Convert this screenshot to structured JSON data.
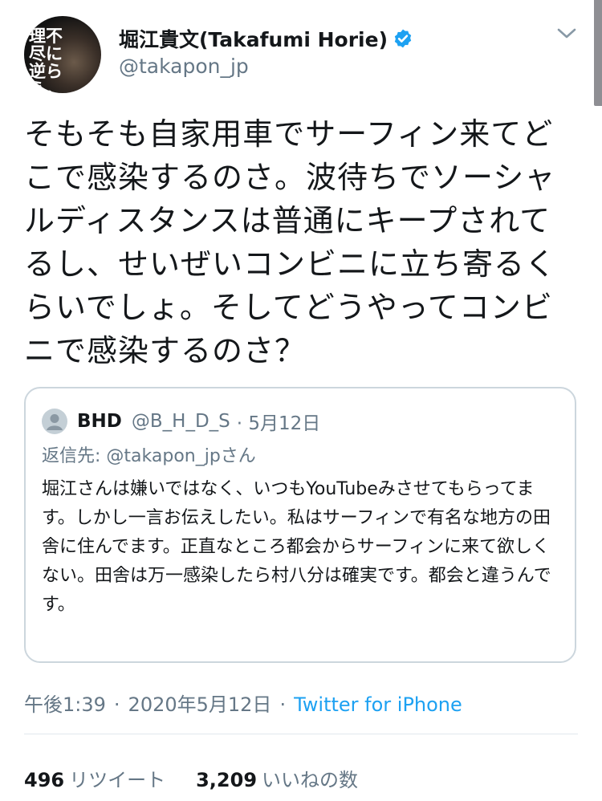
{
  "author": {
    "avatar_text": "理不尽に逆らえ。",
    "display_name": "堀江貴文(Takafumi Horie)",
    "handle": "@takapon_jp",
    "verified_icon": "verified-badge-icon"
  },
  "tweet": {
    "text": "そもそも自家用車でサーフィン来てどこで感染するのさ。波待ちでソーシャルディスタンスは普通にキープされてるし、せいぜいコンビニに立ち寄るくらいでしょ。そしてどうやってコンビニで感染するのさ？"
  },
  "quote": {
    "name": "BHD",
    "handle": "@B_H_D_S",
    "date": "· 5月12日",
    "reply_to": "返信先: @takapon_jpさん",
    "text": "堀江さんは嫌いではなく、いつもYouTubeみさせてもらってます。しかし一言お伝えしたい。私はサーフィンで有名な地方の田舎に住んでます。正直なところ都会からサーフィンに来て欲しくない。田舎は万一感染したら村八分は確実です。都会と違うんです。"
  },
  "meta": {
    "time": "午後1:39",
    "separator": "·",
    "date": "2020年5月12日",
    "source": "Twitter for iPhone"
  },
  "stats": {
    "retweets": "496",
    "retweets_label": "リツイート",
    "likes": "3,209",
    "likes_label": "いいねの数"
  },
  "colors": {
    "accent": "#1da1f2",
    "secondary_text": "#657786",
    "border": "#ccd6dd"
  }
}
